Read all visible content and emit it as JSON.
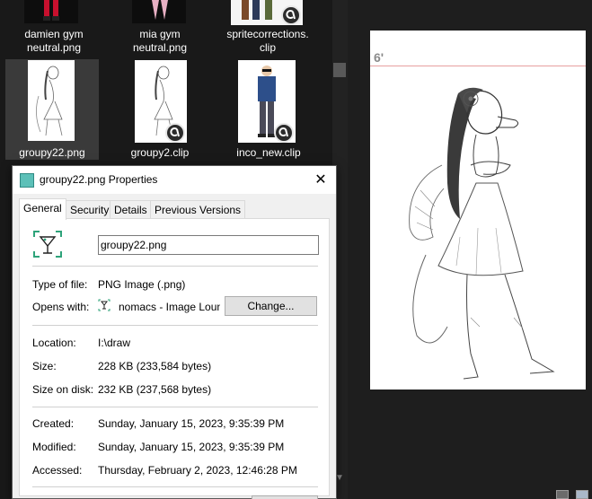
{
  "explorer": {
    "files_row1": [
      {
        "label_line1": "damien gym",
        "label_line2": "neutral.png",
        "type": "png"
      },
      {
        "label_line1": "mia gym",
        "label_line2": "neutral.png",
        "type": "png"
      },
      {
        "label_line1": "spritecorrections.",
        "label_line2": "clip",
        "type": "clip"
      }
    ],
    "files_row2": [
      {
        "label": "groupy22.png",
        "type": "png",
        "selected": true
      },
      {
        "label": "groupy2.clip",
        "type": "clip"
      },
      {
        "label": "inco_new.clip",
        "type": "clip"
      }
    ]
  },
  "preview": {
    "height_mark": "6'"
  },
  "dialog": {
    "title": "groupy22.png Properties",
    "close_icon": "close-icon",
    "tabs": [
      {
        "label": "General",
        "active": true
      },
      {
        "label": "Security"
      },
      {
        "label": "Details"
      },
      {
        "label": "Previous Versions"
      }
    ],
    "general": {
      "filename": "groupy22.png",
      "type_label": "Type of file:",
      "type_value": "PNG Image (.png)",
      "opens_label": "Opens with:",
      "opens_value": "nomacs - Image Lounge",
      "change_label": "Change...",
      "location_label": "Location:",
      "location_value": "I:\\draw",
      "size_label": "Size:",
      "size_value": "228 KB (233,584 bytes)",
      "size_disk_label": "Size on disk:",
      "size_disk_value": "232 KB (237,568 bytes)",
      "created_label": "Created:",
      "created_value": "Sunday, January 15, 2023, 9:35:39 PM",
      "modified_label": "Modified:",
      "modified_value": "Sunday, January 15, 2023, 9:35:39 PM",
      "accessed_label": "Accessed:",
      "accessed_value": "Thursday, February 2, 2023, 12:46:28 PM"
    }
  },
  "colors": {
    "explorer_bg": "#191919",
    "accent_teal": "#2ea37a",
    "selection": "#3a3a3a"
  }
}
